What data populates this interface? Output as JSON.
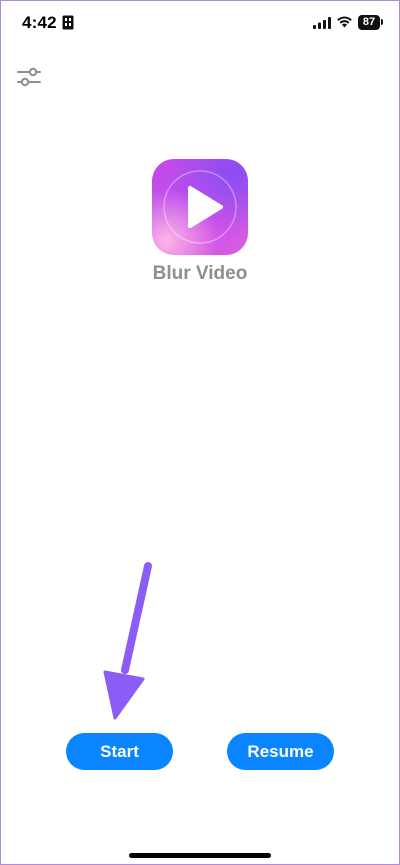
{
  "status_bar": {
    "time": "4:42",
    "battery": "87"
  },
  "icons": {
    "settings": "sliders-icon",
    "sim": "sim-card-icon",
    "signal": "cellular-signal-icon",
    "wifi": "wifi-icon",
    "app": "play-icon"
  },
  "app": {
    "name": "Blur Video"
  },
  "actions": {
    "start_label": "Start",
    "resume_label": "Resume"
  },
  "colors": {
    "accent": "#0a84ff",
    "annotation_arrow": "#8b5cf6",
    "app_name_text": "#8e8e93"
  }
}
